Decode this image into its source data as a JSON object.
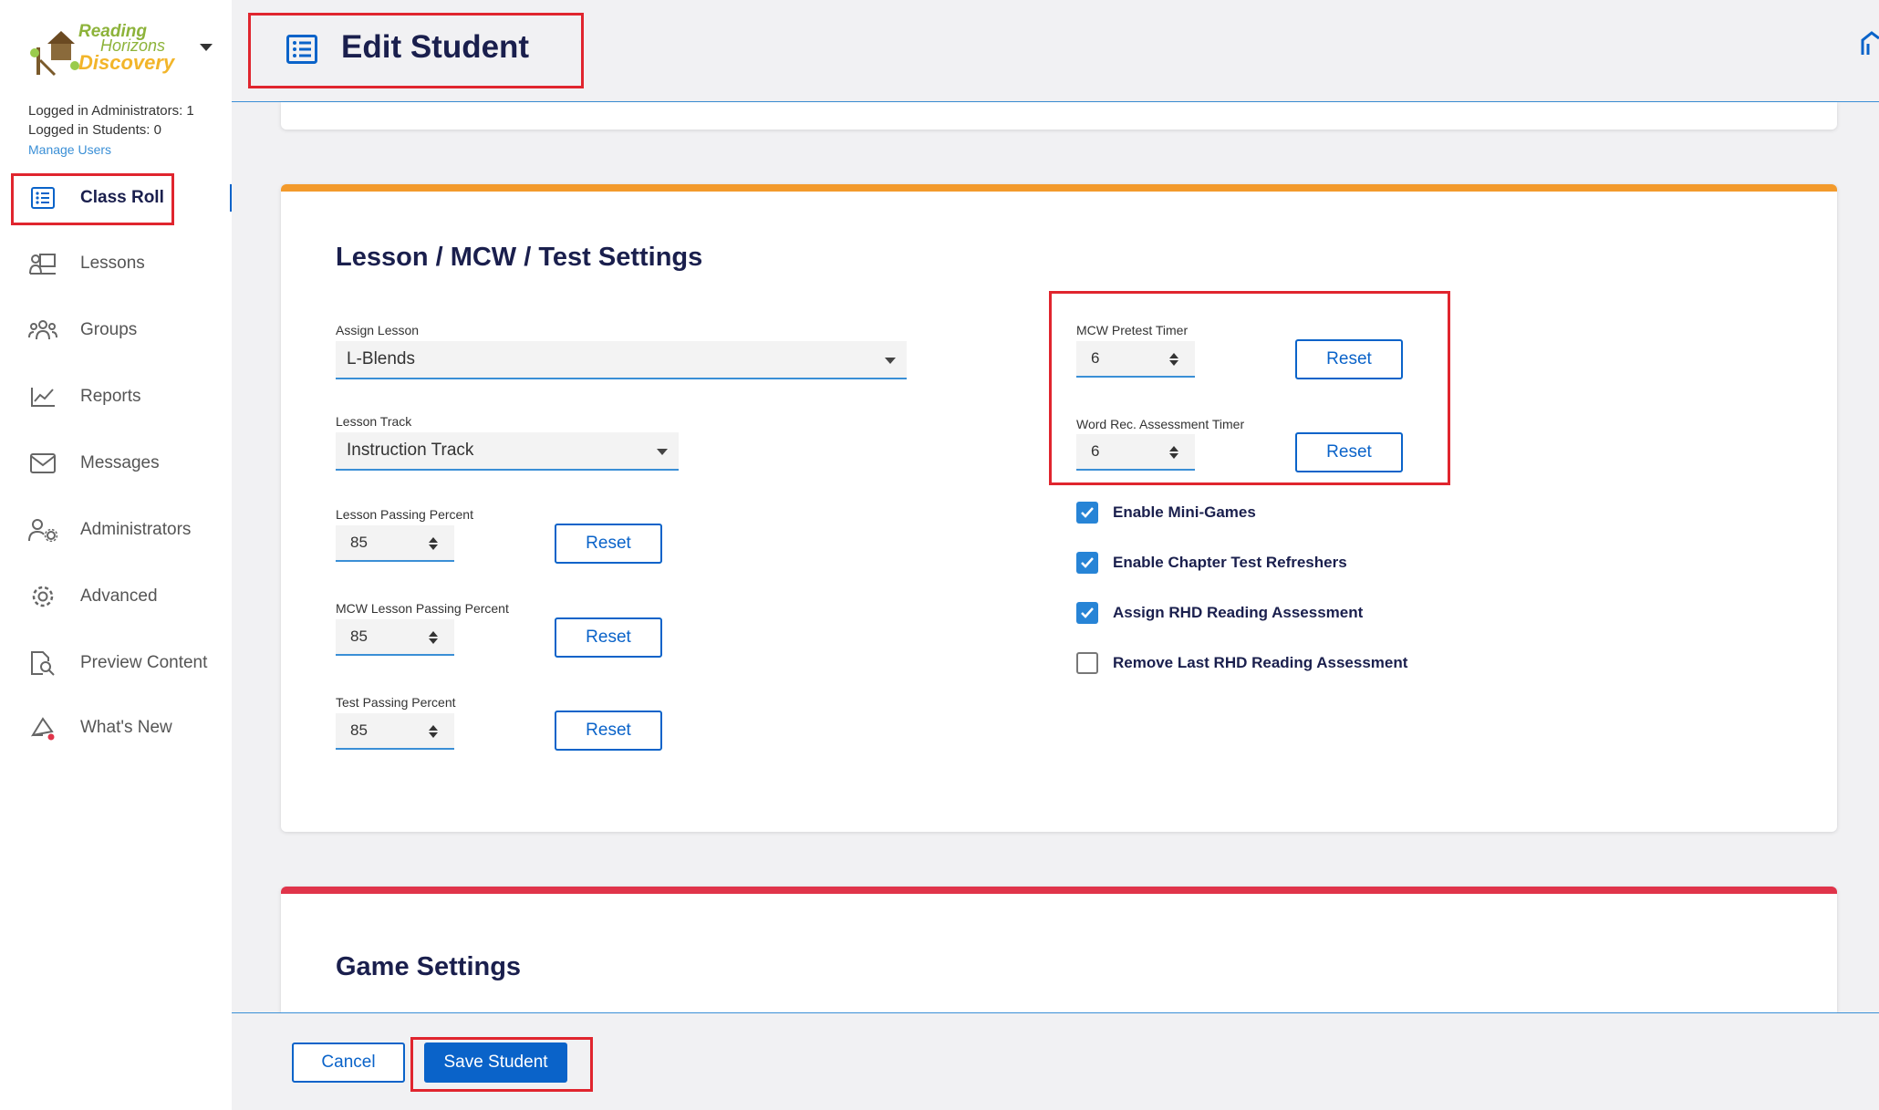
{
  "brand": {
    "logo_line1": "Reading",
    "logo_line2": "Horizons",
    "logo_line3": "Discovery"
  },
  "session": {
    "logged_admins": "Logged in Administrators: 1",
    "logged_students": "Logged in Students: 0",
    "manage_users": "Manage Users"
  },
  "nav": {
    "items": [
      {
        "label": "Class Roll",
        "icon": "list-icon"
      },
      {
        "label": "Lessons",
        "icon": "lessons-icon"
      },
      {
        "label": "Groups",
        "icon": "groups-icon"
      },
      {
        "label": "Reports",
        "icon": "chart-icon"
      },
      {
        "label": "Messages",
        "icon": "envelope-icon"
      },
      {
        "label": "Administrators",
        "icon": "admin-gear-icon"
      },
      {
        "label": "Advanced",
        "icon": "gear-icon"
      },
      {
        "label": "Preview Content",
        "icon": "document-search-icon"
      },
      {
        "label": "What's New",
        "icon": "megaphone-icon"
      }
    ]
  },
  "header": {
    "title": "Edit Student"
  },
  "lesson_settings": {
    "title": "Lesson / MCW / Test Settings",
    "assign_lesson_label": "Assign Lesson",
    "assign_lesson_value": "L-Blends",
    "lesson_track_label": "Lesson Track",
    "lesson_track_value": "Instruction Track",
    "lesson_passing_label": "Lesson Passing Percent",
    "lesson_passing_value": "85",
    "mcw_passing_label": "MCW Lesson Passing Percent",
    "mcw_passing_value": "85",
    "test_passing_label": "Test Passing Percent",
    "test_passing_value": "85",
    "mcw_pretest_label": "MCW Pretest Timer",
    "mcw_pretest_value": "6",
    "word_rec_label": "Word Rec. Assessment Timer",
    "word_rec_value": "6",
    "reset_label": "Reset",
    "checkboxes": [
      {
        "label": "Enable Mini-Games",
        "checked": true
      },
      {
        "label": "Enable Chapter Test Refreshers",
        "checked": true
      },
      {
        "label": "Assign RHD Reading Assessment",
        "checked": true
      },
      {
        "label": "Remove Last RHD Reading Assessment",
        "checked": false
      }
    ]
  },
  "game_settings": {
    "title": "Game Settings"
  },
  "footer": {
    "cancel_label": "Cancel",
    "save_label": "Save Student"
  },
  "colors": {
    "primary": "#0a63c9",
    "navy": "#1a1f4d",
    "lesson_accent": "#f39a2b",
    "game_accent": "#e0344a",
    "annotation": "#e0252e"
  }
}
